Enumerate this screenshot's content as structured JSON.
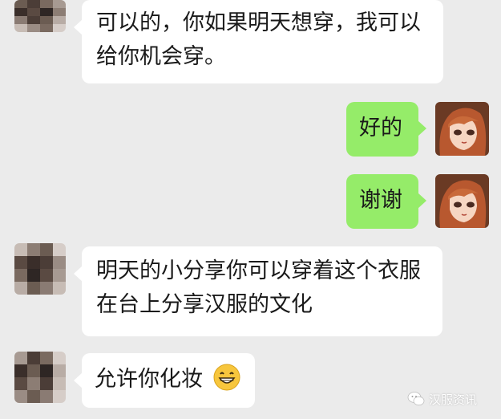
{
  "messages": [
    {
      "sender": "other",
      "text": "可以的，你如果明天想穿，我可以给你机会穿。"
    },
    {
      "sender": "self",
      "text": "好的"
    },
    {
      "sender": "self",
      "text": "谢谢"
    },
    {
      "sender": "other",
      "text": "明天的小分享你可以穿着这个衣服在台上分享汉服的文化"
    },
    {
      "sender": "other",
      "text": "允许你化妆",
      "emoji": "grinning-face-emoji"
    }
  ],
  "watermark": {
    "text": "汉服资讯",
    "icon": "wechat-icon"
  },
  "colors": {
    "background": "#ebebeb",
    "self_bubble": "#95ec69",
    "other_bubble": "#ffffff"
  }
}
